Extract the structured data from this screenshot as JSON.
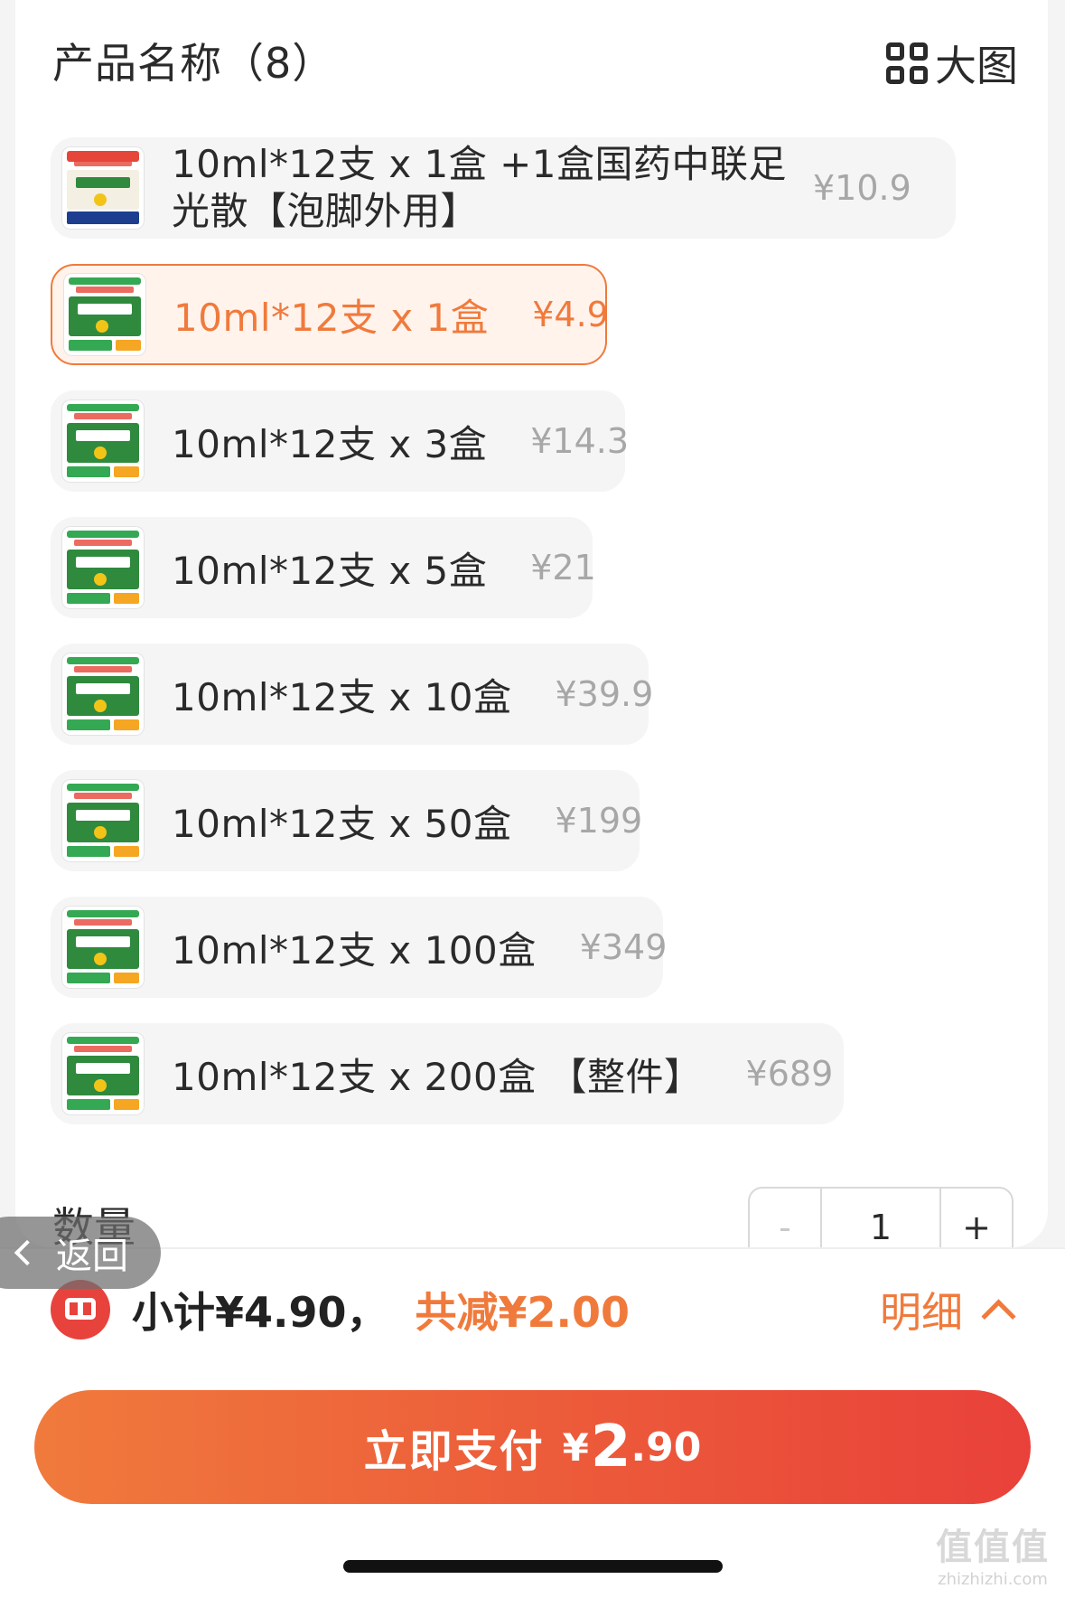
{
  "header": {
    "title": "产品名称（8）",
    "large_view_label": "大图"
  },
  "options": [
    {
      "label": "10ml*12支 x 1盒 +1盒国药中联足光散【泡脚外用】",
      "price": "¥10.9",
      "selected": false
    },
    {
      "label": "10ml*12支 x 1盒",
      "price": "¥4.9",
      "selected": true
    },
    {
      "label": "10ml*12支 x 3盒",
      "price": "¥14.3",
      "selected": false
    },
    {
      "label": "10ml*12支 x 5盒",
      "price": "¥21",
      "selected": false
    },
    {
      "label": "10ml*12支 x 10盒",
      "price": "¥39.9",
      "selected": false
    },
    {
      "label": "10ml*12支 x 50盒",
      "price": "¥199",
      "selected": false
    },
    {
      "label": "10ml*12支 x 100盒",
      "price": "¥349",
      "selected": false
    },
    {
      "label": "10ml*12支 x 200盒 【整件】",
      "price": "¥689",
      "selected": false
    }
  ],
  "quantity": {
    "label": "数量",
    "minus": "-",
    "value": "1",
    "plus": "+"
  },
  "back": {
    "label": "返回"
  },
  "summary": {
    "subtotal": "小计¥4.90，",
    "discount": "共减¥2.00",
    "detail_label": "明细"
  },
  "pay_button": {
    "label": "立即支付",
    "currency": "¥",
    "amount_int": "2",
    "amount_dec": ".90"
  },
  "watermark": {
    "top": "值值值",
    "bottom": "zhizhizhi.com"
  },
  "colors": {
    "accent": "#f07a3c",
    "pay_gradient_end": "#e9413a",
    "coupon_red": "#e8423d"
  }
}
